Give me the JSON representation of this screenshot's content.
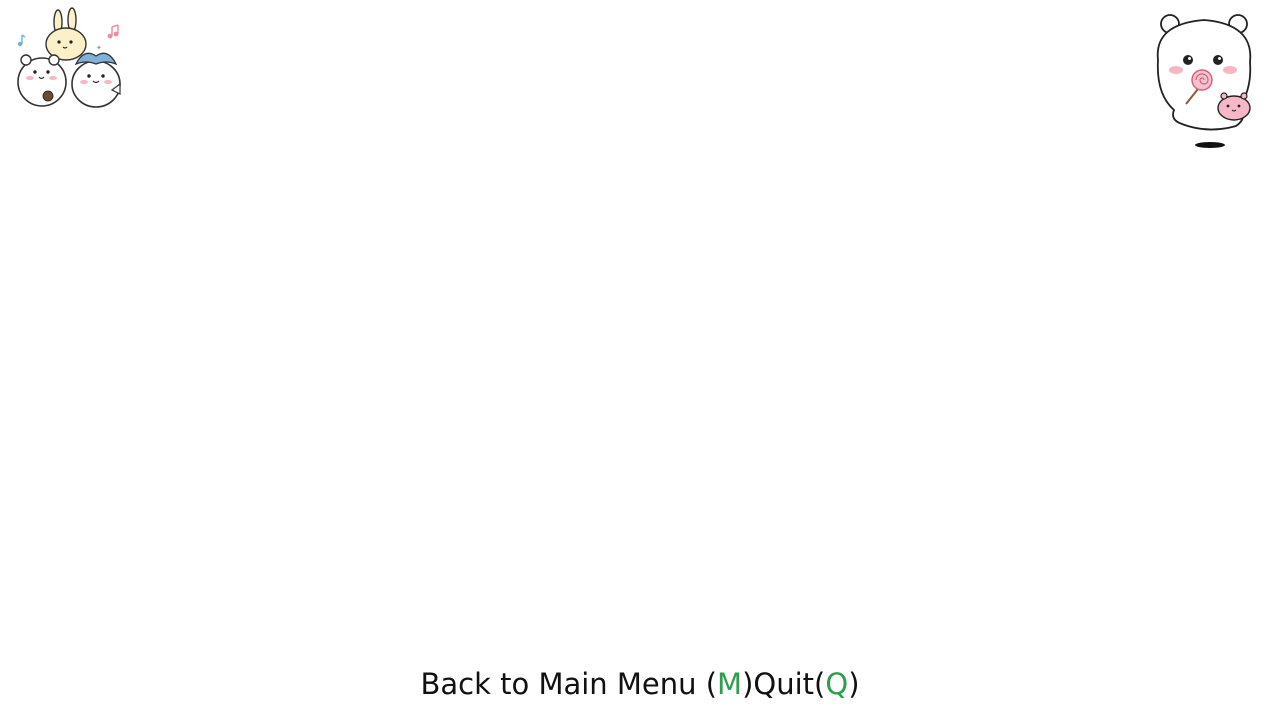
{
  "footer": {
    "back_prefix": "Back to Main Menu (",
    "back_key": "M",
    "back_suffix": ")",
    "quit_prefix": "Quit(",
    "quit_key": "Q",
    "quit_suffix": ")"
  },
  "colors": {
    "background": "#ffffff",
    "text": "#111111",
    "key_highlight": "#2e9e4e"
  },
  "icons": {
    "top_left": "three-characters-music-icon",
    "top_right": "white-bear-lollipop-icon"
  }
}
